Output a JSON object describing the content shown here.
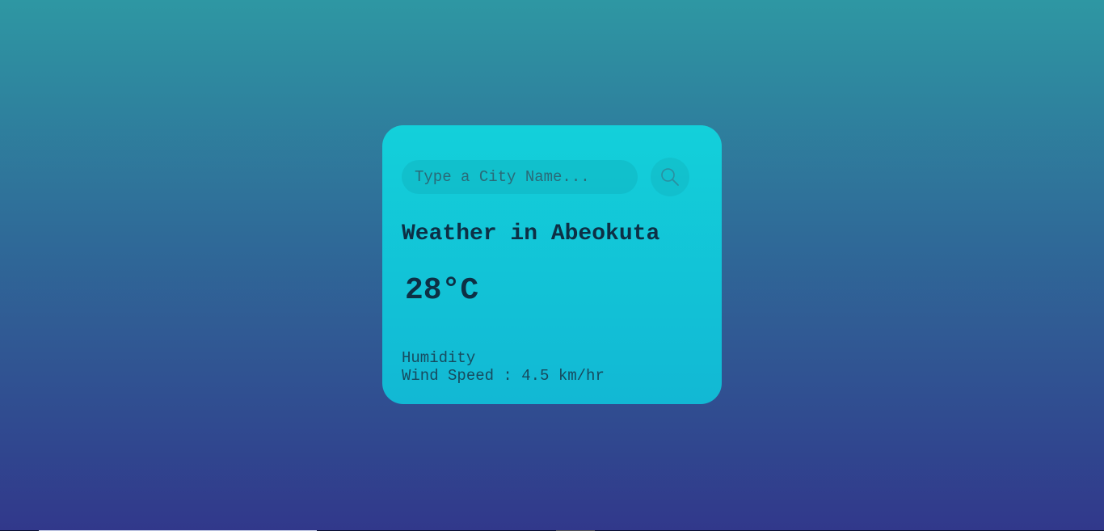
{
  "search": {
    "placeholder": "Type a City Name...",
    "value": ""
  },
  "weather": {
    "title": "Weather in Abeokuta",
    "temperature": "28°C",
    "humidity_label": "Humidity",
    "wind_speed": "Wind Speed : 4.5 km/hr"
  },
  "colors": {
    "card_top": "#13d0da",
    "card_bottom": "#12b8d4",
    "text": "#0d2f45"
  }
}
